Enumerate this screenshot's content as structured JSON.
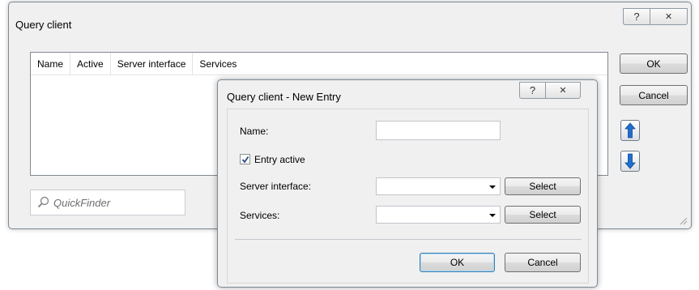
{
  "main_window": {
    "title": "Query client",
    "help_glyph": "?",
    "close_glyph": "✕",
    "columns": [
      "Name",
      "Active",
      "Server interface",
      "Services"
    ],
    "quickfinder_placeholder": "QuickFinder",
    "ok_label": "OK",
    "cancel_label": "Cancel"
  },
  "dialog": {
    "title": "Query client - New Entry",
    "help_glyph": "?",
    "close_glyph": "✕",
    "name_label": "Name:",
    "name_value": "",
    "entry_active_label": "Entry active",
    "entry_active_checked": true,
    "server_interface_label": "Server interface:",
    "server_interface_value": "",
    "services_label": "Services:",
    "services_value": "",
    "select_label": "Select",
    "ok_label": "OK",
    "cancel_label": "Cancel"
  },
  "colors": {
    "arrow_blue": "#1f6fcf",
    "window_bg": "#f0f0f0"
  }
}
